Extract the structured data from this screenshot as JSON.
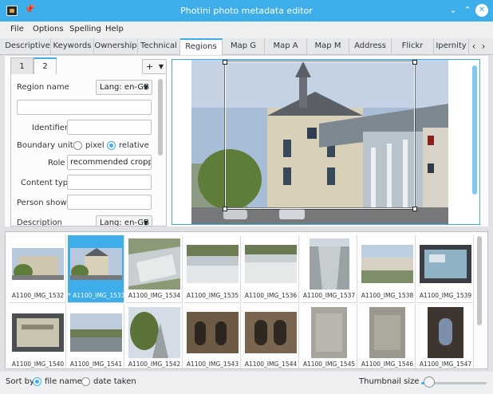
{
  "window": {
    "title": "Photini photo metadata editor",
    "controls": {
      "minimize": "⌄",
      "maximize": "⌃",
      "close": "✕"
    }
  },
  "menu": [
    "File",
    "Options",
    "Spelling",
    "Help"
  ],
  "tabs": {
    "items": [
      "Descriptive",
      "Keywords",
      "Ownership",
      "Technical",
      "Regions",
      "Map G",
      "Map A",
      "Map M",
      "Address",
      "Flickr",
      "Ipernity"
    ],
    "active": "Regions",
    "scroll_left": "‹",
    "scroll_right": "›"
  },
  "regions": {
    "subtabs": [
      "1",
      "2"
    ],
    "active_subtab": "2",
    "add_button": "+",
    "region_name_label": "Region name",
    "lang_combo": "Lang: en-GB",
    "region_name_value": "",
    "identifier_label": "Identifier",
    "identifier_value": "",
    "boundary_unit_label": "Boundary unit",
    "unit_pixel": "pixel",
    "unit_relative": "relative",
    "unit_selected": "relative",
    "role_label": "Role",
    "role_value": "recommended cropping",
    "content_type_label": "Content type",
    "content_type_value": "",
    "person_shown_label": "Person shown",
    "person_shown_value": "",
    "description_label": "Description",
    "description_lang": "Lang: en-GB"
  },
  "thumbnails": [
    {
      "name": "A1100_IMG_1532",
      "selected": false
    },
    {
      "name": "A1100_IMG_1533",
      "selected": true,
      "marker": "*"
    },
    {
      "name": "A1100_IMG_1534",
      "selected": false
    },
    {
      "name": "A1100_IMG_1535",
      "selected": false
    },
    {
      "name": "A1100_IMG_1536",
      "selected": false
    },
    {
      "name": "A1100_IMG_1537",
      "selected": false
    },
    {
      "name": "A1100_IMG_1538",
      "selected": false
    },
    {
      "name": "A1100_IMG_1539",
      "selected": false
    },
    {
      "name": "A1100_IMG_1540",
      "selected": false
    },
    {
      "name": "A1100_IMG_1541",
      "selected": false
    },
    {
      "name": "A1100_IMG_1542",
      "selected": false
    },
    {
      "name": "A1100_IMG_1543",
      "selected": false
    },
    {
      "name": "A1100_IMG_1544",
      "selected": false
    },
    {
      "name": "A1100_IMG_1545",
      "selected": false
    },
    {
      "name": "A1100_IMG_1546",
      "selected": false
    },
    {
      "name": "A1100_IMG_1547",
      "selected": false
    }
  ],
  "bottom": {
    "sort_by_label": "Sort by",
    "sort_file_name": "file name",
    "sort_date_taken": "date taken",
    "sort_selected": "file name",
    "thumbnail_size_label": "Thumbnail size",
    "thumbnail_size_fraction": 0.12
  },
  "colors": {
    "accent": "#3daee9",
    "window_bg": "#eff0f1",
    "panel_bg": "#fcfcfc"
  }
}
